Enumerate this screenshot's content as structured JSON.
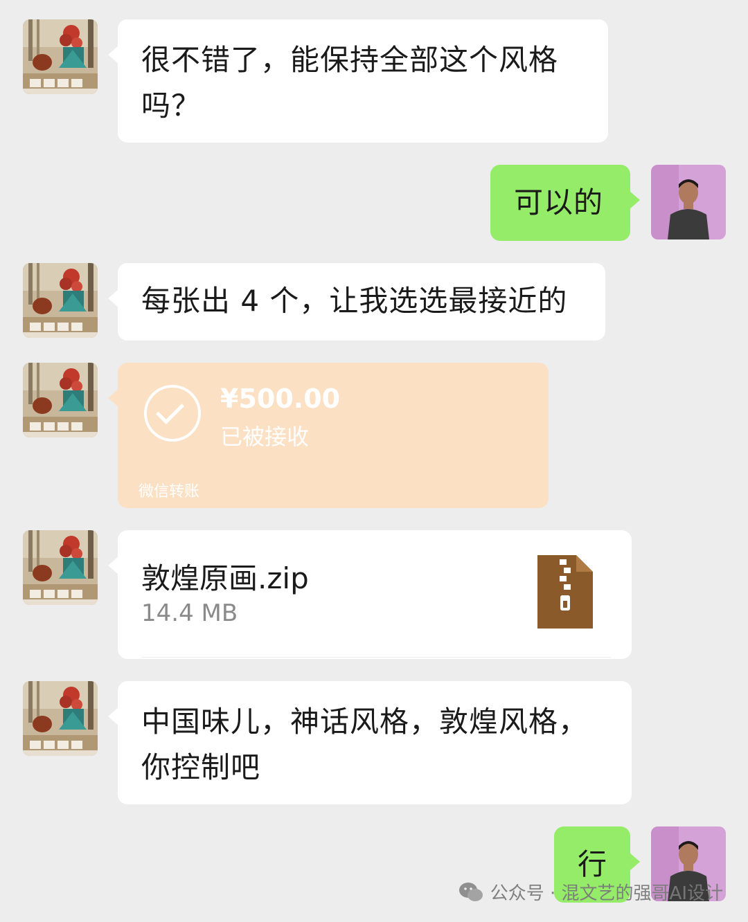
{
  "messages": [
    {
      "sender": "other",
      "text_line1": "很不错了，能保持全部这个风格",
      "text_line2": "吗？"
    },
    {
      "sender": "me",
      "text": "可以的"
    },
    {
      "sender": "other",
      "text": "每张出 4 个，让我选选最接近的"
    },
    {
      "sender": "other",
      "type": "transfer",
      "amount": "¥500.00",
      "status": "已被接收",
      "label": "微信转账"
    },
    {
      "sender": "other",
      "type": "file",
      "file_name": "敦煌原画.zip",
      "file_size": "14.4 MB"
    },
    {
      "sender": "other",
      "text_line1": "中国味儿，神话风格，敦煌风格，",
      "text_line2": "你控制吧"
    },
    {
      "sender": "me",
      "text": "行"
    }
  ],
  "watermark": {
    "text": "公众号 · 混文艺的强哥AI设计"
  },
  "colors": {
    "background": "#ededed",
    "bubble_me": "#95ec69",
    "bubble_other": "#ffffff",
    "transfer": "#fbe0c4",
    "file_icon": "#8b5a2b"
  }
}
